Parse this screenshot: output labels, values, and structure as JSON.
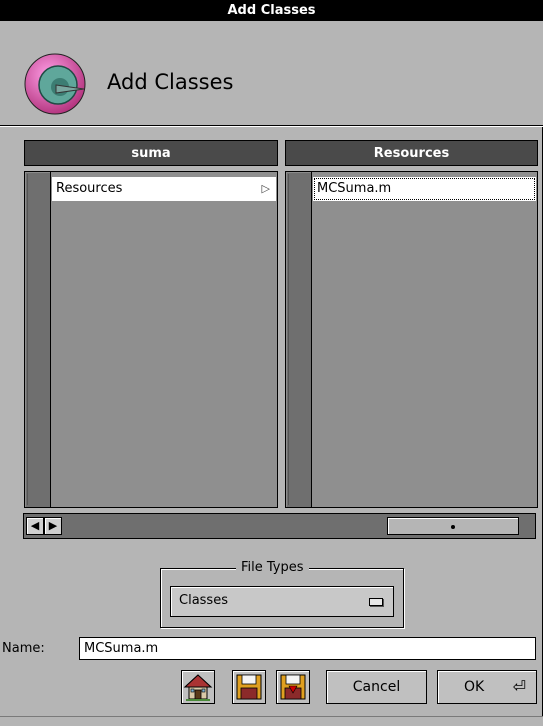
{
  "window": {
    "title": "Add Classes"
  },
  "header": {
    "title": "Add Classes",
    "icon": "add-classes-icon"
  },
  "browser": {
    "columns": [
      {
        "title": "suma",
        "items": [
          {
            "label": "Resources",
            "has_children": true
          }
        ]
      },
      {
        "title": "Resources",
        "items": [
          {
            "label": "MCSuma.m",
            "selected": true
          }
        ]
      }
    ],
    "scroll_left_icon": "arrow-left-icon",
    "scroll_right_icon": "arrow-right-icon"
  },
  "file_types": {
    "label": "File Types",
    "selected": "Classes"
  },
  "name": {
    "label": "Name:",
    "value": "MCSuma.m"
  },
  "buttons": {
    "home_icon": "home-icon",
    "save_icon": "floppy-icon",
    "save_as_icon": "floppy-down-icon",
    "cancel": "Cancel",
    "ok": "OK"
  },
  "colors": {
    "window_bg": "#b5b5b5",
    "column_header": "#4a4a4a",
    "column_body": "#8f8f8f",
    "titlebar": "#000000"
  }
}
